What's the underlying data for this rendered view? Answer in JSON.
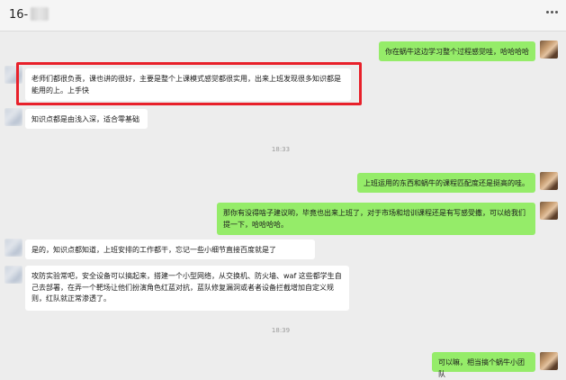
{
  "header": {
    "title": "16-",
    "more_icon": "more-dots-icon"
  },
  "messages": [
    {
      "side": "right",
      "text": "你在蜗牛这边学习整个过程感觉哇，哈哈哈哈"
    },
    {
      "side": "left",
      "text": "老师们都很负责，课也讲的很好，主要是整个上课模式感觉都很实用，出来上班发现很多知识都是能用的上。上手快"
    },
    {
      "side": "left",
      "text": "知识点都是由浅入深，适合零基础"
    },
    {
      "side": "right",
      "text": "上班运用的东西和蜗牛的课程匹配度还是挺高的哇。"
    },
    {
      "side": "right",
      "text": "那你有没得啥子建议哟，毕竟也出来上班了，对于市场和培训课程还是有写感受撒，可以给我们提一下，哈哈哈哈。"
    },
    {
      "side": "left",
      "text": "是的，知识点都知道，上班安排的工作都干，忘记一些小细节直接百度就是了"
    },
    {
      "side": "left",
      "text": "攻防实验常吧，安全设备可以搞起来，搭建一个小型网络，从交换机、防火墙、waf 这些都学生自己去部署，在弄一个靶场让他们扮演角色红蓝对抗，蓝队修复漏洞或者者设备拦截增加自定义规则，红队就正常渗透了。"
    },
    {
      "side": "right",
      "text": "可以嘛，相当搞个蜗牛小团队"
    }
  ],
  "timestamps": [
    "18:33",
    "18:39"
  ],
  "colors": {
    "self_bubble": "#95ec69",
    "other_bubble": "#ffffff",
    "highlight": "#e8202a",
    "background": "#ededed"
  }
}
